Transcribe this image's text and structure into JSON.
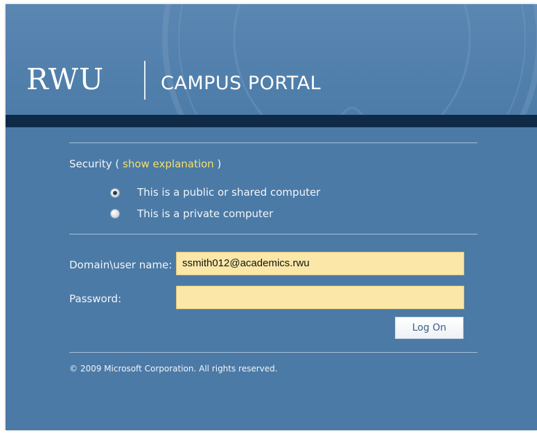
{
  "header": {
    "logo_wordmark": "RWU",
    "logo_subtitle": "CAMPUS PORTAL"
  },
  "security": {
    "label": "Security (",
    "link": "show explanation",
    "close": ")",
    "options": [
      {
        "label": "This is a public or shared computer",
        "selected": true
      },
      {
        "label": "This is a private computer",
        "selected": false
      }
    ]
  },
  "form": {
    "username_label": "Domain\\user name:",
    "username_value": "ssmith012@academics.rwu",
    "password_label": "Password:",
    "password_value": "",
    "logon_button": "Log On"
  },
  "footer": {
    "copyright": "© 2009 Microsoft Corporation. All rights reserved."
  },
  "colors": {
    "background": "#4b7aa6",
    "band": "#0f2a47",
    "link": "#f4e06a",
    "input_fill": "#fbe8a8"
  }
}
